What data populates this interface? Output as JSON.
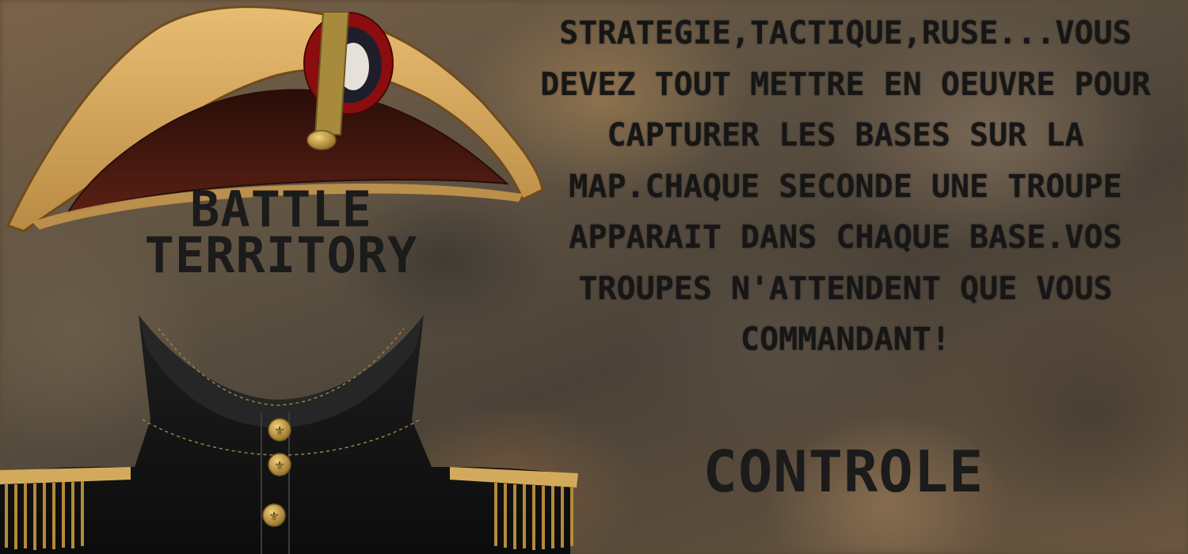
{
  "game": {
    "title": "BATTLE TERRITORY",
    "description": "STRATEGIE,TACTIQUE,RUSE...VOUS DEVEZ TOUT METTRE EN OEUVRE POUR CAPTURER LES BASES SUR LA MAP.CHAQUE SECONDE UNE TROUPE APPARAIT DANS CHAQUE BASE.VOS TROUPES N'ATTENDENT QUE VOUS COMMANDANT!",
    "controls_label": "CONTROLE"
  },
  "colors": {
    "text": "#1b1b1b",
    "hat_gold": "#d9a85a",
    "hat_brown": "#4a1a12",
    "uniform": "#141414",
    "epaulette": "#c9a050",
    "cockade_red": "#8b0d10"
  },
  "icons": [
    "bicorne-hat-icon",
    "cockade-icon",
    "uniform-jacket-icon",
    "fleur-de-lis-button-icon",
    "epaulette-icon"
  ]
}
